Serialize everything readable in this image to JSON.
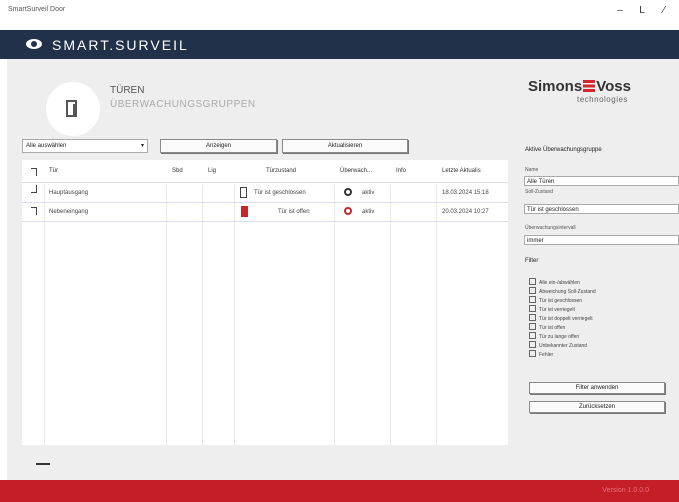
{
  "window": {
    "title": "SmartSurveil Door",
    "min": "–",
    "max": "L",
    "close": "⁄"
  },
  "brand": {
    "name": "SMART.SURVEIL"
  },
  "section": {
    "title": "TÜREN",
    "subtitle": "ÜBERWACHUNGSGRUPPEN"
  },
  "logo": {
    "part1": "Simons",
    "part2": "Voss",
    "sub": "technologies"
  },
  "toolbar": {
    "select_value": "Alle auswählen",
    "select_arrow": "▾",
    "btn1": "Anzeigen",
    "btn2": "Aktualisieren"
  },
  "table": {
    "headers": {
      "tuer": "Tür",
      "sbd": "Sbd",
      "lig": "Lig",
      "status": "Türzustand",
      "ueberw": "Überwach...",
      "info": "Info",
      "last": "Letzte Aktualis"
    },
    "rows": [
      {
        "name": "Hauptausgang",
        "status_text": "Tür ist geschlossen",
        "ueberw_text": "aktiv",
        "date": "18.03.2024 15:18"
      },
      {
        "name": "Nebeneingang",
        "status_text": "Tür ist offen",
        "ueberw_text": "aktiv",
        "date": "20.03.2024 10:27"
      }
    ]
  },
  "panel": {
    "title": "Aktive Überwachungsgruppe",
    "name_label": "Name",
    "name_value": "Alle Türen",
    "status_label": "Soll-Zustand",
    "status_value": "Tür ist geschlossen",
    "interval_label": "Überwachungsintervall",
    "interval_value": "immer",
    "filter_label": "Filter",
    "filters": [
      "Alle ein-/abwählen",
      "Abweichung Soll-Zustand",
      "Tür ist geschlossen",
      "Tür ist verriegelt",
      "Tür ist doppelt verriegelt",
      "Tür ist offen",
      "Tür zu lange offen",
      "Unbekannter Zustand",
      "Fehler"
    ],
    "btn_apply": "Filter anwenden",
    "btn_reset": "Zurücksetzen"
  },
  "footer": {
    "text": "Version 1.0.0.0"
  },
  "colors": {
    "brand_bar": "#21314a",
    "accent_red": "#c41e26",
    "door_open": "#c8242b"
  },
  "icons": {
    "brand": "eye-icon",
    "door": "door-icon",
    "ring": "ring-icon"
  }
}
